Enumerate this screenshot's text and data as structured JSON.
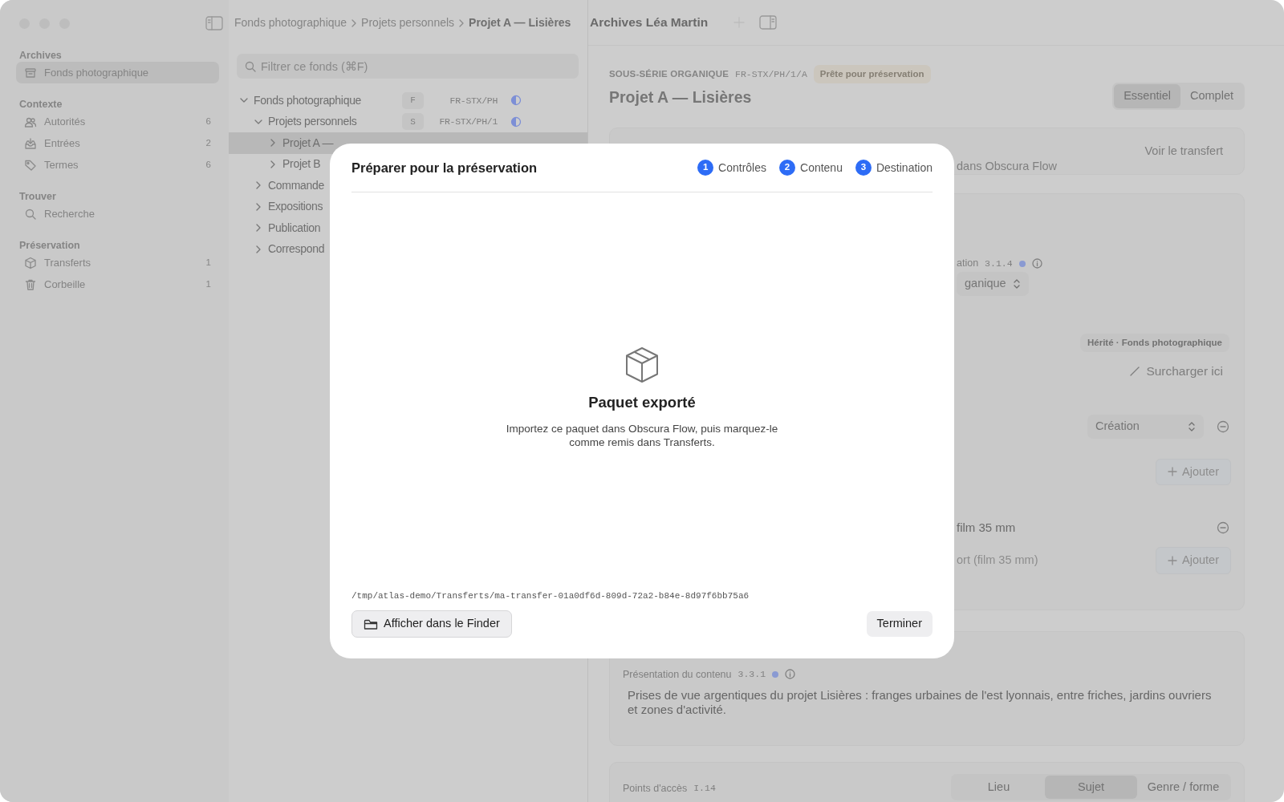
{
  "breadcrumb": [
    {
      "label": "Fonds photographique",
      "current": false
    },
    {
      "label": "Projets personnels",
      "current": false
    },
    {
      "label": "Projet A — Lisières",
      "current": true
    }
  ],
  "window_title": "Archives Léa Martin",
  "sidebar": [
    {
      "title": "Archives",
      "items": [
        {
          "label": "Fonds photographique",
          "selected": true
        }
      ]
    },
    {
      "title": "Contexte",
      "items": [
        {
          "label": "Autorités",
          "count": "6",
          "selected": false
        },
        {
          "label": "Entrées",
          "count": "2",
          "selected": false
        },
        {
          "label": "Termes",
          "count": "6",
          "selected": false
        }
      ]
    },
    {
      "title": "Trouver",
      "items": [
        {
          "label": "Recherche",
          "selected": false
        }
      ]
    },
    {
      "title": "Préservation",
      "items": [
        {
          "label": "Transferts",
          "count": "1",
          "selected": false
        },
        {
          "label": "Corbeille",
          "count": "1",
          "selected": false
        }
      ]
    }
  ],
  "tree": {
    "search": {
      "placeholder": "Filtrer ce fonds (⌘F)"
    },
    "rows": [
      {
        "label": "Fonds photographique",
        "level": "F",
        "code": "FR-STX/PH",
        "expanded": true,
        "selected": false,
        "children": [
          {
            "label": "Projets personnels",
            "level": "S",
            "code": "FR-STX/PH/1",
            "expanded": true,
            "selected": false,
            "children": [
              {
                "label": "Projet A —",
                "expanded": false,
                "selected": true
              },
              {
                "label": "Projet B",
                "expanded": false,
                "selected": false
              }
            ]
          },
          {
            "label": "Commande",
            "expanded": false,
            "selected": false
          },
          {
            "label": "Expositions",
            "expanded": false,
            "selected": false
          },
          {
            "label": "Publication",
            "expanded": false,
            "selected": false
          },
          {
            "label": "Correspond",
            "expanded": false,
            "selected": false
          }
        ]
      }
    ]
  },
  "record": {
    "type": "SOUS-SÉRIE ORGANIQUE",
    "code": "FR-STX/PH/1/A",
    "status": "Prête pour préservation",
    "title": "Projet A — Lisières",
    "views": [
      {
        "label": "Essentiel",
        "selected": true
      },
      {
        "label": "Complet",
        "selected": false
      }
    ],
    "transfer": {
      "text": "dans Obscura Flow",
      "link": "Voir le transfert"
    },
    "fields": [
      {
        "kind": "label",
        "text": "ation",
        "ref": "3.1.4"
      },
      {
        "kind": "select",
        "value": "ganique"
      },
      {
        "kind": "badge",
        "text": "Hérité · Fonds photographique"
      },
      {
        "kind": "action",
        "text": "Surcharger ici"
      },
      {
        "kind": "select-remove",
        "value": "Création"
      },
      {
        "kind": "add",
        "text": "Ajouter"
      },
      {
        "kind": "value-remove",
        "text": "film 35 mm"
      },
      {
        "kind": "placeholder-add",
        "placeholder": "ort (film 35 mm)",
        "button": "Ajouter"
      }
    ],
    "content": {
      "label": "Présentation du contenu",
      "ref": "3.3.1",
      "text": "Prises de vue argentiques du projet Lisières : franges urbaines de l'est lyonnais, entre friches, jardins ouvriers et zones d'activité."
    },
    "access": {
      "label": "Points d'accès",
      "ref": "I.14",
      "tabs": [
        {
          "label": "Lieu",
          "selected": false
        },
        {
          "label": "Sujet",
          "selected": true
        },
        {
          "label": "Genre / forme",
          "selected": false
        }
      ]
    }
  },
  "dialog": {
    "title": "Préparer pour la préservation",
    "steps": [
      {
        "number": "1",
        "label": "Contrôles",
        "done": true
      },
      {
        "number": "2",
        "label": "Contenu",
        "done": true
      },
      {
        "number": "3",
        "label": "Destination",
        "done": true
      }
    ],
    "heading": "Paquet exporté",
    "message": "Importez ce paquet dans Obscura Flow, puis marquez-le comme remis dans Transferts.",
    "path": "/tmp/atlas-demo/Transferts/ma-transfer-01a0df6d-809d-72a2-b84e-8d97f6bb75a6",
    "buttons": [
      {
        "kind": "secondary",
        "label": "Afficher dans le Finder"
      },
      {
        "kind": "plain",
        "label": "Terminer"
      }
    ]
  }
}
